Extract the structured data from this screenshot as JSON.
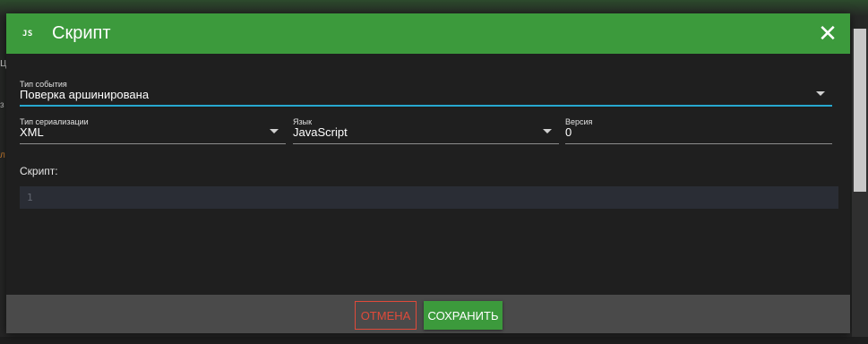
{
  "dialog": {
    "title": "Скрипт",
    "badge": "JS",
    "close_icon": "close-icon",
    "event_type": {
      "label": "Тип события",
      "value": "Поверка аршинирована"
    },
    "serialization": {
      "label": "Тип сериализации",
      "value": "XML"
    },
    "language": {
      "label": "Язык",
      "value": "JavaScript"
    },
    "version": {
      "label": "Версия",
      "value": "0"
    },
    "script_label": "Скрипт:",
    "editor": {
      "line_numbers": [
        "1"
      ]
    },
    "cancel_label": "ОТМЕНА",
    "save_label": "СОХРАНИТЬ"
  },
  "colors": {
    "accent_green": "#3c9a3c",
    "focus_blue": "#27a8cf",
    "cancel_red": "#e04a3a"
  }
}
